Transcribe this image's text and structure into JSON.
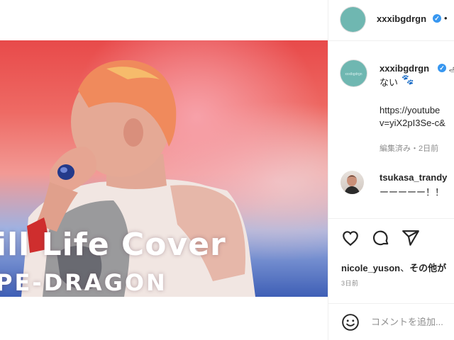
{
  "post": {
    "image_title": "ill Life Cover",
    "image_subtitle": "PE-DRAGON"
  },
  "header": {
    "username": "xxxibgdrgn",
    "separator": "•"
  },
  "caption": {
    "username": "xxxibgdrgn",
    "text_line1": "ஆ",
    "text_line2": "ない",
    "link_line1": "https://youtube",
    "link_line2": "v=yiX2pI3Se-c&",
    "meta": "編集済み・2日前",
    "avatar_mark": "xxxibgdrgn"
  },
  "comment": {
    "username": "tsukasa_trandy",
    "text": "ーーーーー！！"
  },
  "likes": {
    "user": "nicole_yuson",
    "connector": "、",
    "others": "その他が"
  },
  "date": "3日前",
  "add_comment": {
    "placeholder": "コメントを追加..."
  },
  "icons": [
    "heart-icon",
    "comment-icon",
    "share-icon",
    "emoji-icon",
    "verified-icon"
  ],
  "colors": {
    "avatar_bg": "#6fb7b1",
    "verified": "#3897f0",
    "muted": "#8e8e8e",
    "border": "#efefef"
  }
}
